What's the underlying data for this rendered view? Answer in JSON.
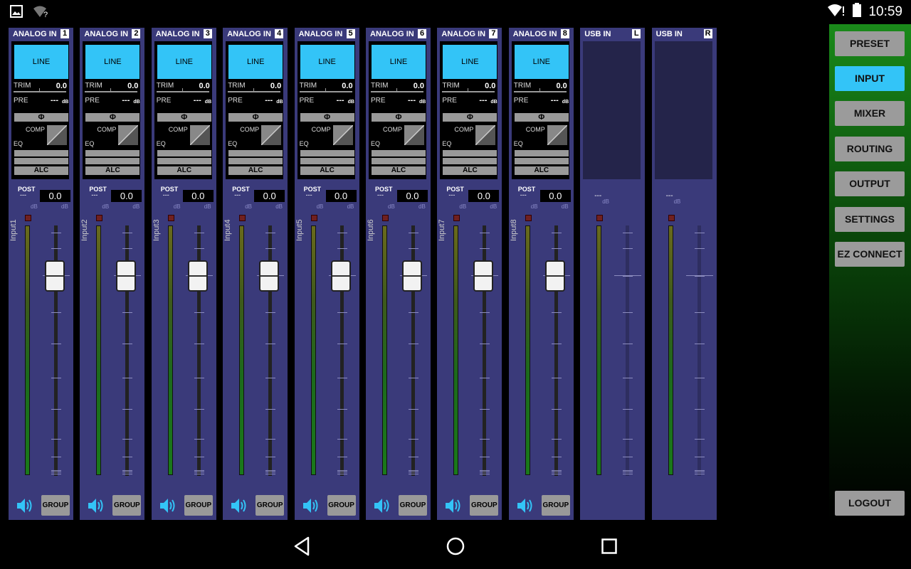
{
  "status": {
    "time": "10:59"
  },
  "channels": [
    {
      "title": "ANALOG IN",
      "num": "1",
      "name": "Input1"
    },
    {
      "title": "ANALOG IN",
      "num": "2",
      "name": "Input2"
    },
    {
      "title": "ANALOG IN",
      "num": "3",
      "name": "Input3"
    },
    {
      "title": "ANALOG IN",
      "num": "4",
      "name": "Input4"
    },
    {
      "title": "ANALOG IN",
      "num": "5",
      "name": "Input5"
    },
    {
      "title": "ANALOG IN",
      "num": "6",
      "name": "Input6"
    },
    {
      "title": "ANALOG IN",
      "num": "7",
      "name": "Input7"
    },
    {
      "title": "ANALOG IN",
      "num": "8",
      "name": "Input8"
    }
  ],
  "usb": [
    {
      "title": "USB IN",
      "num": "L"
    },
    {
      "title": "USB IN",
      "num": "R"
    }
  ],
  "strip": {
    "line": "LINE",
    "trim": "TRIM",
    "trim_value": "0.0",
    "pre": "PRE",
    "pre_value": "---",
    "db": "dB",
    "phase": "Φ",
    "comp": "COMP",
    "eq": "EQ",
    "alc": "ALC",
    "post": "POST",
    "post_dash": "---",
    "post_value": "0.0",
    "group": "GROUP"
  },
  "menu": {
    "preset": "PRESET",
    "input": "INPUT",
    "mixer": "MIXER",
    "routing": "ROUTING",
    "output": "OUTPUT",
    "settings": "SETTINGS",
    "ez_connect": "EZ CONNECT",
    "logout": "LOGOUT",
    "active": "INPUT"
  },
  "fader_level": 0.8,
  "colors": {
    "accent": "#33c4f7",
    "strip": "#3a3a7a",
    "button": "#9b9b9b"
  },
  "icons": [
    "image-icon",
    "wifi-unknown-icon",
    "wifi-alert-icon",
    "battery-icon",
    "speaker-icon",
    "back-icon",
    "home-icon",
    "recents-icon"
  ]
}
